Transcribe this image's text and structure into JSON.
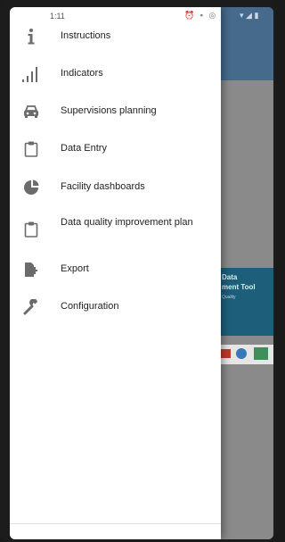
{
  "status_bar": {
    "time": "1:11"
  },
  "drawer": {
    "items": [
      {
        "label": "Instructions",
        "icon": "info-icon"
      },
      {
        "label": "Indicators",
        "icon": "signal-bars-icon"
      },
      {
        "label": "Supervisions planning",
        "icon": "car-icon"
      },
      {
        "label": "Data Entry",
        "icon": "clipboard-icon"
      },
      {
        "label": "Facility dashboards",
        "icon": "pie-chart-icon"
      },
      {
        "label": "Data quality improvement plan",
        "icon": "clipboard-icon"
      },
      {
        "label": "Export",
        "icon": "file-export-icon"
      },
      {
        "label": "Configuration",
        "icon": "wrench-icon"
      }
    ]
  },
  "background_app": {
    "banner_title_line1": "Data",
    "banner_title_line2": "ment Tool",
    "banner_subtitle": "Quality"
  },
  "colors": {
    "drawer_bg": "#ffffff",
    "icon": "#6b6b6b",
    "app_bar": "#456a8c",
    "banner": "#1d5f7a"
  }
}
